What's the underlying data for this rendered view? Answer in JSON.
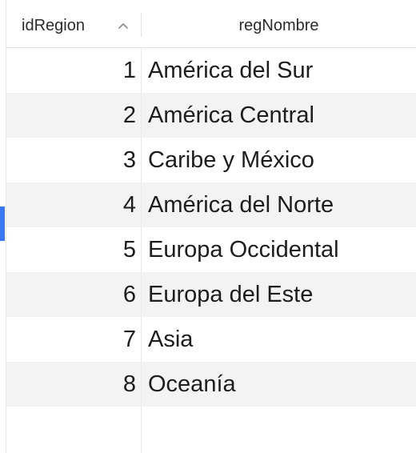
{
  "table": {
    "columns": [
      {
        "label": "idRegion",
        "sorted": "ascending"
      },
      {
        "label": "regNombre"
      }
    ],
    "rows": [
      {
        "idRegion": "1",
        "regNombre": "América del Sur"
      },
      {
        "idRegion": "2",
        "regNombre": "América Central"
      },
      {
        "idRegion": "3",
        "regNombre": "Caribe y México"
      },
      {
        "idRegion": "4",
        "regNombre": "América del Norte"
      },
      {
        "idRegion": "5",
        "regNombre": "Europa Occidental"
      },
      {
        "idRegion": "6",
        "regNombre": "Europa del Este"
      },
      {
        "idRegion": "7",
        "regNombre": "Asia"
      },
      {
        "idRegion": "8",
        "regNombre": "Oceanía"
      }
    ]
  },
  "colors": {
    "selection_marker": "#3b76f6",
    "alt_row": "#f3f3f3",
    "text": "#1d1d1f"
  },
  "icons": {
    "sort": "chevron-up-icon"
  }
}
